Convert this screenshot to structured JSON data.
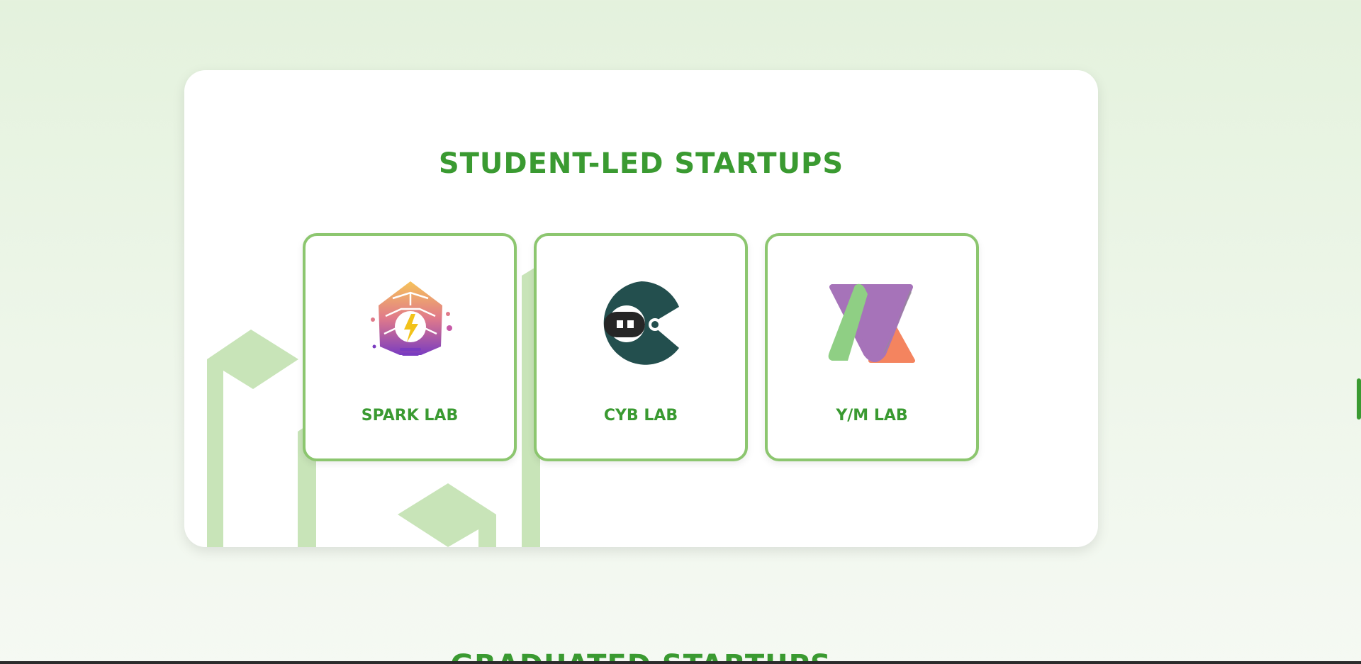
{
  "startups_section": {
    "title": "STUDENT-LED STARTUPS",
    "cards": [
      {
        "label": "SPARK LAB",
        "logo_icon": "spark-lab-lightbulb-logo"
      },
      {
        "label": "CYB LAB",
        "logo_icon": "cyb-lab-robot-logo"
      },
      {
        "label": "Y/M LAB",
        "logo_icon": "ym-lab-triangles-logo"
      }
    ]
  },
  "next_section": {
    "title": "GRADUATED STARTUPS"
  },
  "colors": {
    "accent_green": "#3a9a31",
    "card_border": "#8cc66f",
    "decor_green": "#c8e4b8",
    "page_background": "#e6f2df"
  }
}
